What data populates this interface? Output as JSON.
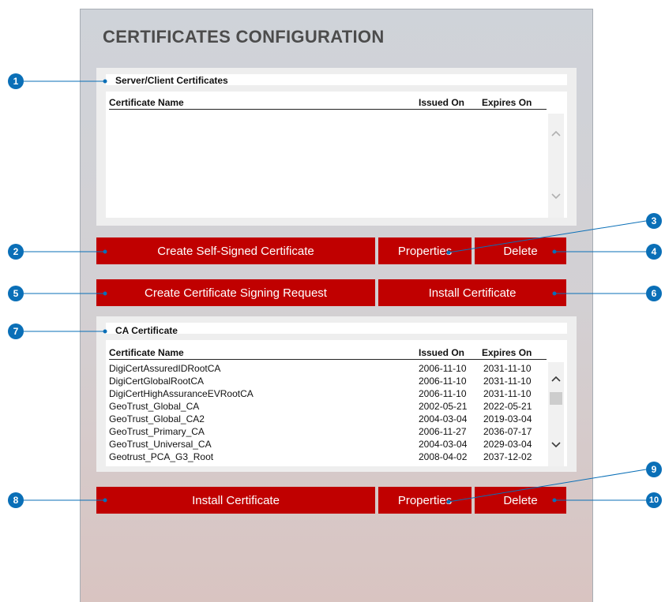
{
  "page_title": "CERTIFICATES CONFIGURATION",
  "server_section": {
    "title": "Server/Client Certificates",
    "columns": {
      "name": "Certificate Name",
      "issued": "Issued On",
      "expires": "Expires On"
    },
    "rows": []
  },
  "server_buttons": {
    "create_self_signed": "Create Self-Signed Certificate",
    "properties": "Properties",
    "delete": "Delete",
    "create_csr": "Create Certificate Signing Request",
    "install": "Install Certificate"
  },
  "ca_section": {
    "title": "CA Certificate",
    "columns": {
      "name": "Certificate Name",
      "issued": "Issued On",
      "expires": "Expires On"
    },
    "rows": [
      {
        "name": "DigiCertAssuredIDRootCA",
        "issued": "2006-11-10",
        "expires": "2031-11-10"
      },
      {
        "name": "DigiCertGlobalRootCA",
        "issued": "2006-11-10",
        "expires": "2031-11-10"
      },
      {
        "name": "DigiCertHighAssuranceEVRootCA",
        "issued": "2006-11-10",
        "expires": "2031-11-10"
      },
      {
        "name": "GeoTrust_Global_CA",
        "issued": "2002-05-21",
        "expires": "2022-05-21"
      },
      {
        "name": "GeoTrust_Global_CA2",
        "issued": "2004-03-04",
        "expires": "2019-03-04"
      },
      {
        "name": "GeoTrust_Primary_CA",
        "issued": "2006-11-27",
        "expires": "2036-07-17"
      },
      {
        "name": "GeoTrust_Universal_CA",
        "issued": "2004-03-04",
        "expires": "2029-03-04"
      },
      {
        "name": "Geotrust_PCA_G3_Root",
        "issued": "2008-04-02",
        "expires": "2037-12-02"
      }
    ]
  },
  "ca_buttons": {
    "install": "Install Certificate",
    "properties": "Properties",
    "delete": "Delete"
  },
  "callouts": [
    "1",
    "2",
    "3",
    "4",
    "5",
    "6",
    "7",
    "8",
    "9",
    "10"
  ],
  "colors": {
    "button_red": "#c00000",
    "callout_blue": "#0a6fb7"
  }
}
